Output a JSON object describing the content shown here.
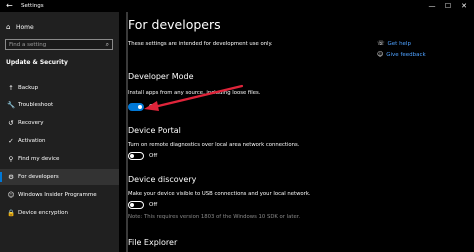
{
  "window": {
    "title": "Settings",
    "controls": [
      {
        "name": "minimize-button",
        "glyph": "—"
      },
      {
        "name": "maximize-button",
        "glyph": "☐"
      },
      {
        "name": "close-button",
        "glyph": "✕"
      }
    ]
  },
  "sidebar": {
    "home_label": "Home",
    "search_placeholder": "Find a setting",
    "section_title": "Update & Security",
    "items": [
      {
        "label": "Backup",
        "icon": "backup-icon",
        "glyph": "↑"
      },
      {
        "label": "Troubleshoot",
        "icon": "wrench-icon",
        "glyph": "🔧"
      },
      {
        "label": "Recovery",
        "icon": "recovery-icon",
        "glyph": "↺"
      },
      {
        "label": "Activation",
        "icon": "activation-icon",
        "glyph": "✓"
      },
      {
        "label": "Find my device",
        "icon": "person-icon",
        "glyph": "⚲"
      },
      {
        "label": "For developers",
        "icon": "developer-icon",
        "glyph": "⚙",
        "active": true
      },
      {
        "label": "Windows Insider Programme",
        "icon": "insider-icon",
        "glyph": "☺"
      },
      {
        "label": "Device encryption",
        "icon": "lock-icon",
        "glyph": "🔒"
      }
    ]
  },
  "main": {
    "title": "For developers",
    "intro": "These settings are intended for development use only.",
    "links": {
      "help": "Get help",
      "feedback": "Give feedback"
    },
    "developer_mode": {
      "title": "Developer Mode",
      "desc": "Install apps from any source, including loose files.",
      "state": "On"
    },
    "device_portal": {
      "title": "Device Portal",
      "desc": "Turn on remote diagnostics over local area network connections.",
      "state": "Off"
    },
    "device_discovery": {
      "title": "Device discovery",
      "desc": "Make your device visible to USB connections and your local network.",
      "state": "Off",
      "note": "Note: This requires version 1803 of the Windows 10 SDK or later."
    },
    "file_explorer": {
      "title": "File Explorer"
    }
  },
  "colors": {
    "accent": "#0078d7",
    "annotation_arrow": "#e0243a",
    "link": "#4ea1ff"
  }
}
